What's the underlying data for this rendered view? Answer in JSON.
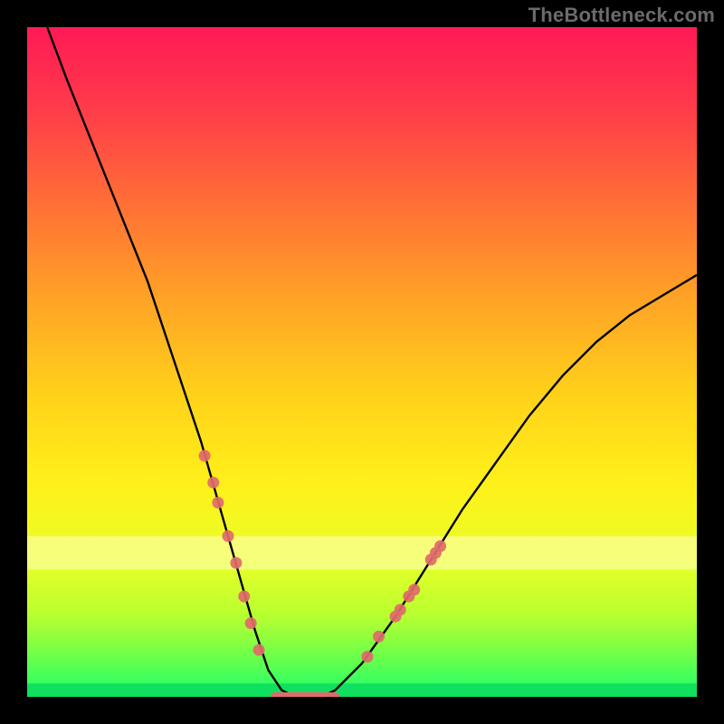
{
  "watermark": "TheBottleneck.com",
  "chart_data": {
    "type": "line",
    "title": "",
    "xlabel": "",
    "ylabel": "",
    "xlim": [
      0,
      100
    ],
    "ylim": [
      0,
      100
    ],
    "series": [
      {
        "name": "bottleneck-curve",
        "x": [
          3,
          6,
          10,
          14,
          18,
          22,
          24,
          26,
          28,
          30,
          32,
          34,
          36,
          38,
          40,
          42,
          44,
          46,
          50,
          55,
          60,
          65,
          70,
          75,
          80,
          85,
          90,
          95,
          100
        ],
        "y": [
          100,
          92,
          82,
          72,
          62,
          50,
          44,
          38,
          31,
          24,
          17,
          10,
          4,
          1,
          0,
          0,
          0,
          1,
          5,
          12,
          20,
          28,
          35,
          42,
          48,
          53,
          57,
          60,
          63
        ]
      }
    ],
    "optimal_zone_y": [
      0,
      2
    ],
    "threshold_band_y": [
      19,
      24
    ],
    "curve_markers": [
      {
        "x": 26.5,
        "y": 36
      },
      {
        "x": 27.8,
        "y": 32
      },
      {
        "x": 28.5,
        "y": 29
      },
      {
        "x": 30.0,
        "y": 24
      },
      {
        "x": 31.2,
        "y": 20
      },
      {
        "x": 32.4,
        "y": 15
      },
      {
        "x": 33.4,
        "y": 11
      },
      {
        "x": 34.6,
        "y": 7
      },
      {
        "x": 50.8,
        "y": 6
      },
      {
        "x": 52.5,
        "y": 9
      },
      {
        "x": 55.0,
        "y": 12
      },
      {
        "x": 55.7,
        "y": 13
      },
      {
        "x": 57.0,
        "y": 15
      },
      {
        "x": 57.8,
        "y": 16
      },
      {
        "x": 60.3,
        "y": 20.5
      },
      {
        "x": 61.0,
        "y": 21.5
      },
      {
        "x": 61.7,
        "y": 22.5
      }
    ],
    "flat_segment": {
      "x_start": 37,
      "x_end": 46,
      "y": 0
    }
  }
}
